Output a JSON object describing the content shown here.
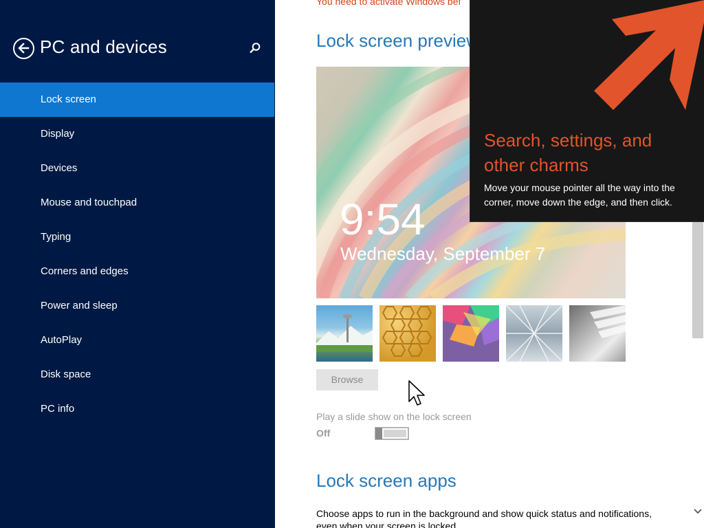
{
  "sidebar": {
    "title": "PC and devices",
    "back_icon": "back-arrow-icon",
    "search_icon": "search-icon",
    "items": [
      {
        "label": "Lock screen",
        "active": true
      },
      {
        "label": "Display"
      },
      {
        "label": "Devices"
      },
      {
        "label": "Mouse and touchpad"
      },
      {
        "label": "Typing"
      },
      {
        "label": "Corners and edges"
      },
      {
        "label": "Power and sleep"
      },
      {
        "label": "AutoPlay"
      },
      {
        "label": "Disk space"
      },
      {
        "label": "PC info"
      }
    ]
  },
  "main": {
    "activation_message": "You need to activate Windows bef",
    "preview_heading": "Lock screen preview",
    "preview": {
      "time": "9:54",
      "date": "Wednesday, September 7"
    },
    "thumbnails": [
      "seattle-landscape",
      "honeycomb",
      "colored-shapes",
      "train-tunnel",
      "piano-keys"
    ],
    "browse_label": "Browse",
    "slideshow": {
      "label": "Play a slide show on the lock screen",
      "state": "Off"
    },
    "apps_heading": "Lock screen apps",
    "apps_description": "Choose apps to run in the background and show quick status and notifications, even when your screen is locked"
  },
  "charms_hint": {
    "title": "Search, settings, and other charms",
    "body": "Move your mouse pointer all the way into the corner, move down the edge, and then click."
  },
  "colors": {
    "sidebar_bg": "#001944",
    "selected_item": "#0f77d0",
    "heading": "#2678b8",
    "accent_orange": "#e2542b",
    "warning": "#d0451b"
  }
}
